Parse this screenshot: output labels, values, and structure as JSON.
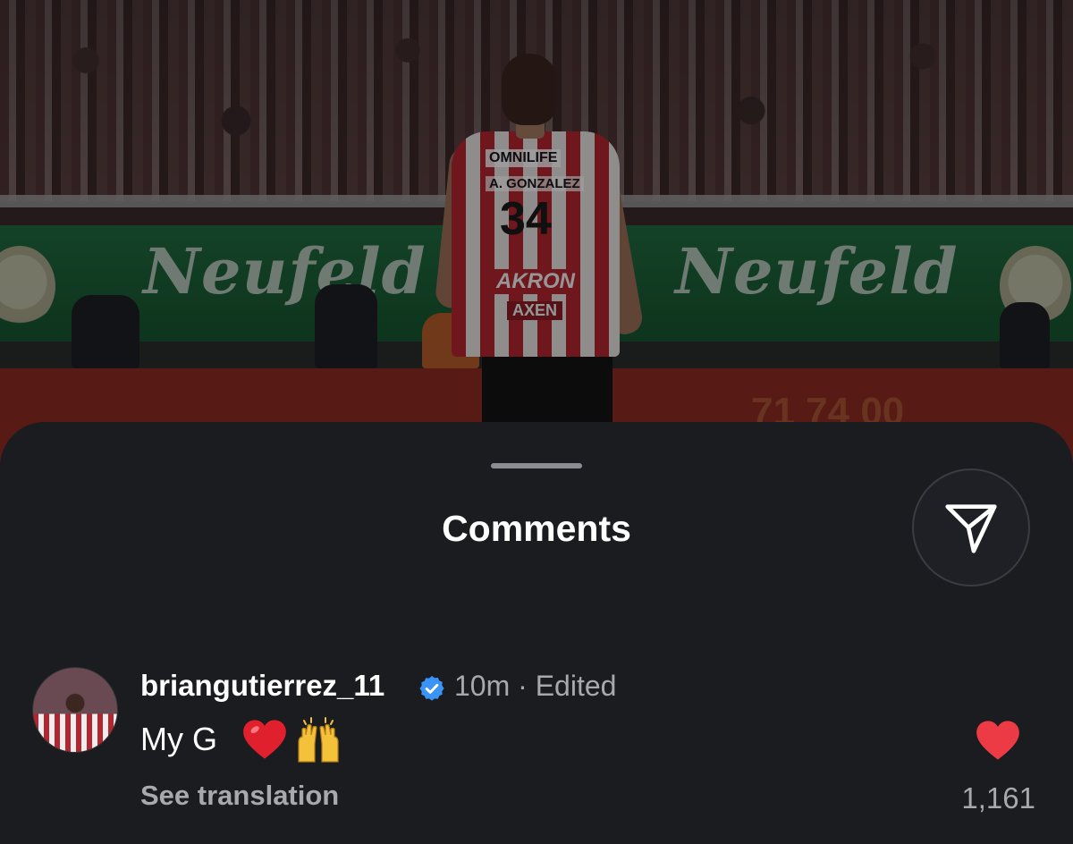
{
  "background_photo": {
    "board_brand": "Neufeld",
    "player_shirt": {
      "sponsor_top": "OMNILIFE",
      "name": "A. GONZALEZ",
      "number": "34",
      "sponsor_main": "AKRON",
      "sponsor_sub": "AXEN"
    },
    "red_board_text": "71 74 00"
  },
  "sheet": {
    "title": "Comments",
    "share_icon": "send-icon"
  },
  "comment": {
    "username": "briangutierrez_11",
    "verified_icon": "verified-badge-icon",
    "time": "10m",
    "separator": "·",
    "edited_label": "Edited",
    "text": "My G",
    "emojis": [
      "red-heart-emoji",
      "raising-hands-emoji"
    ],
    "see_translation": "See translation",
    "like_icon": "heart-filled-icon",
    "like_count": "1,161"
  },
  "colors": {
    "sheet_bg": "#1b1c20",
    "verified_blue": "#3a94f5",
    "like_red": "#ed3b46",
    "secondary_text": "#a8a9ad"
  }
}
